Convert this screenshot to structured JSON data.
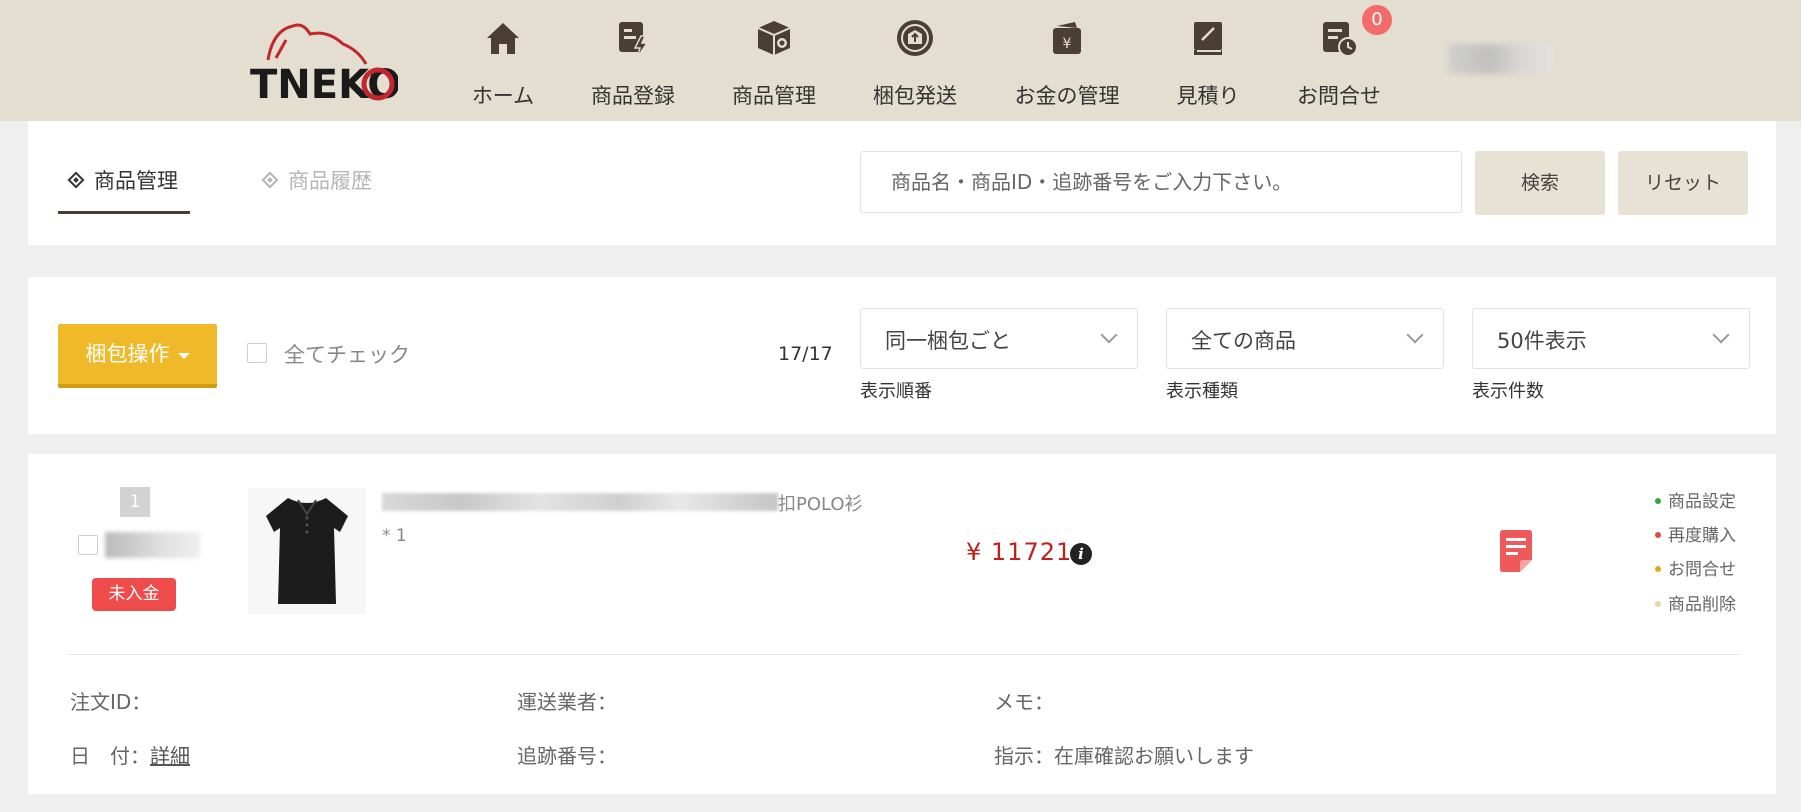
{
  "colors": {
    "header_bg": "#e4ded0",
    "accent_orange": "#f0b929",
    "status_red": "#f04b4b",
    "price_red": "#c0201b",
    "badge_red": "#f46b6b"
  },
  "header": {
    "logo_text": "TNEKO",
    "nav": [
      {
        "label": "ホーム",
        "icon": "home-icon"
      },
      {
        "label": "商品登録",
        "icon": "product-register-icon"
      },
      {
        "label": "商品管理",
        "icon": "box-settings-icon"
      },
      {
        "label": "梱包発送",
        "icon": "package-upload-icon"
      },
      {
        "label": "お金の管理",
        "icon": "wallet-yen-icon"
      },
      {
        "label": "見積り",
        "icon": "estimate-book-icon"
      },
      {
        "label": "お問合せ",
        "icon": "inquiry-clock-icon"
      }
    ],
    "inquiry_badge": "0"
  },
  "tabs": [
    {
      "label": "商品管理",
      "active": true
    },
    {
      "label": "商品履歴",
      "active": false
    }
  ],
  "search": {
    "placeholder": "商品名・商品ID・追跡番号をご入力下さい。",
    "value": "",
    "search_label": "検索",
    "reset_label": "リセット"
  },
  "toolbar": {
    "pack_button": "梱包操作",
    "check_all": "全てチェック",
    "count": "17/17",
    "selects": [
      {
        "value": "同一梱包ごと",
        "caption": "表示順番"
      },
      {
        "value": "全ての商品",
        "caption": "表示種類"
      },
      {
        "value": "50件表示",
        "caption": "表示件数"
      }
    ]
  },
  "order": {
    "index": "1",
    "status": "未入金",
    "product_title_visible": "扣POLO衫",
    "quantity": "* 1",
    "price": "¥ 11721",
    "info_icon": "i",
    "actions": [
      {
        "label": "商品設定",
        "color": "#3aa23a"
      },
      {
        "label": "再度購入",
        "color": "#e04848"
      },
      {
        "label": "お問合せ",
        "color": "#e0a820"
      },
      {
        "label": "商品削除",
        "color": "#e6d6a8"
      }
    ],
    "meta": {
      "order_id_label": "注文ID：",
      "carrier_label": "運送業者：",
      "memo_label": "メモ：",
      "date_label": "日　付：",
      "date_link": "詳細",
      "tracking_label": "追跡番号：",
      "instruction": "指示：在庫確認お願いします"
    }
  }
}
